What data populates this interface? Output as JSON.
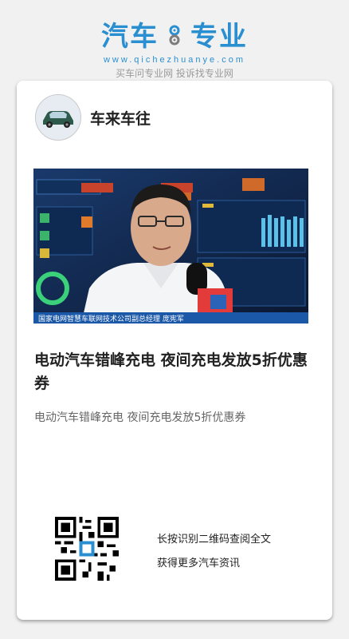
{
  "brand": {
    "title_left": "汽车",
    "title_right": "专业",
    "url": "www.qichezhuanye.com",
    "slogan": "买车问专业网 投诉找专业网"
  },
  "card": {
    "account_name": "车来车往",
    "photo_caption": "国家电网智慧车联网技术公司副总经理 庞宪军",
    "headline": "电动汽车错峰充电 夜间充电发放5折优惠券",
    "summary": "电动汽车错峰充电 夜间充电发放5折优惠券",
    "qr_line1": "长按识别二维码查阅全文",
    "qr_line2": "获得更多汽车资讯"
  },
  "colors": {
    "brand_blue": "#2a8fd0",
    "background": "#f1f1f1"
  }
}
